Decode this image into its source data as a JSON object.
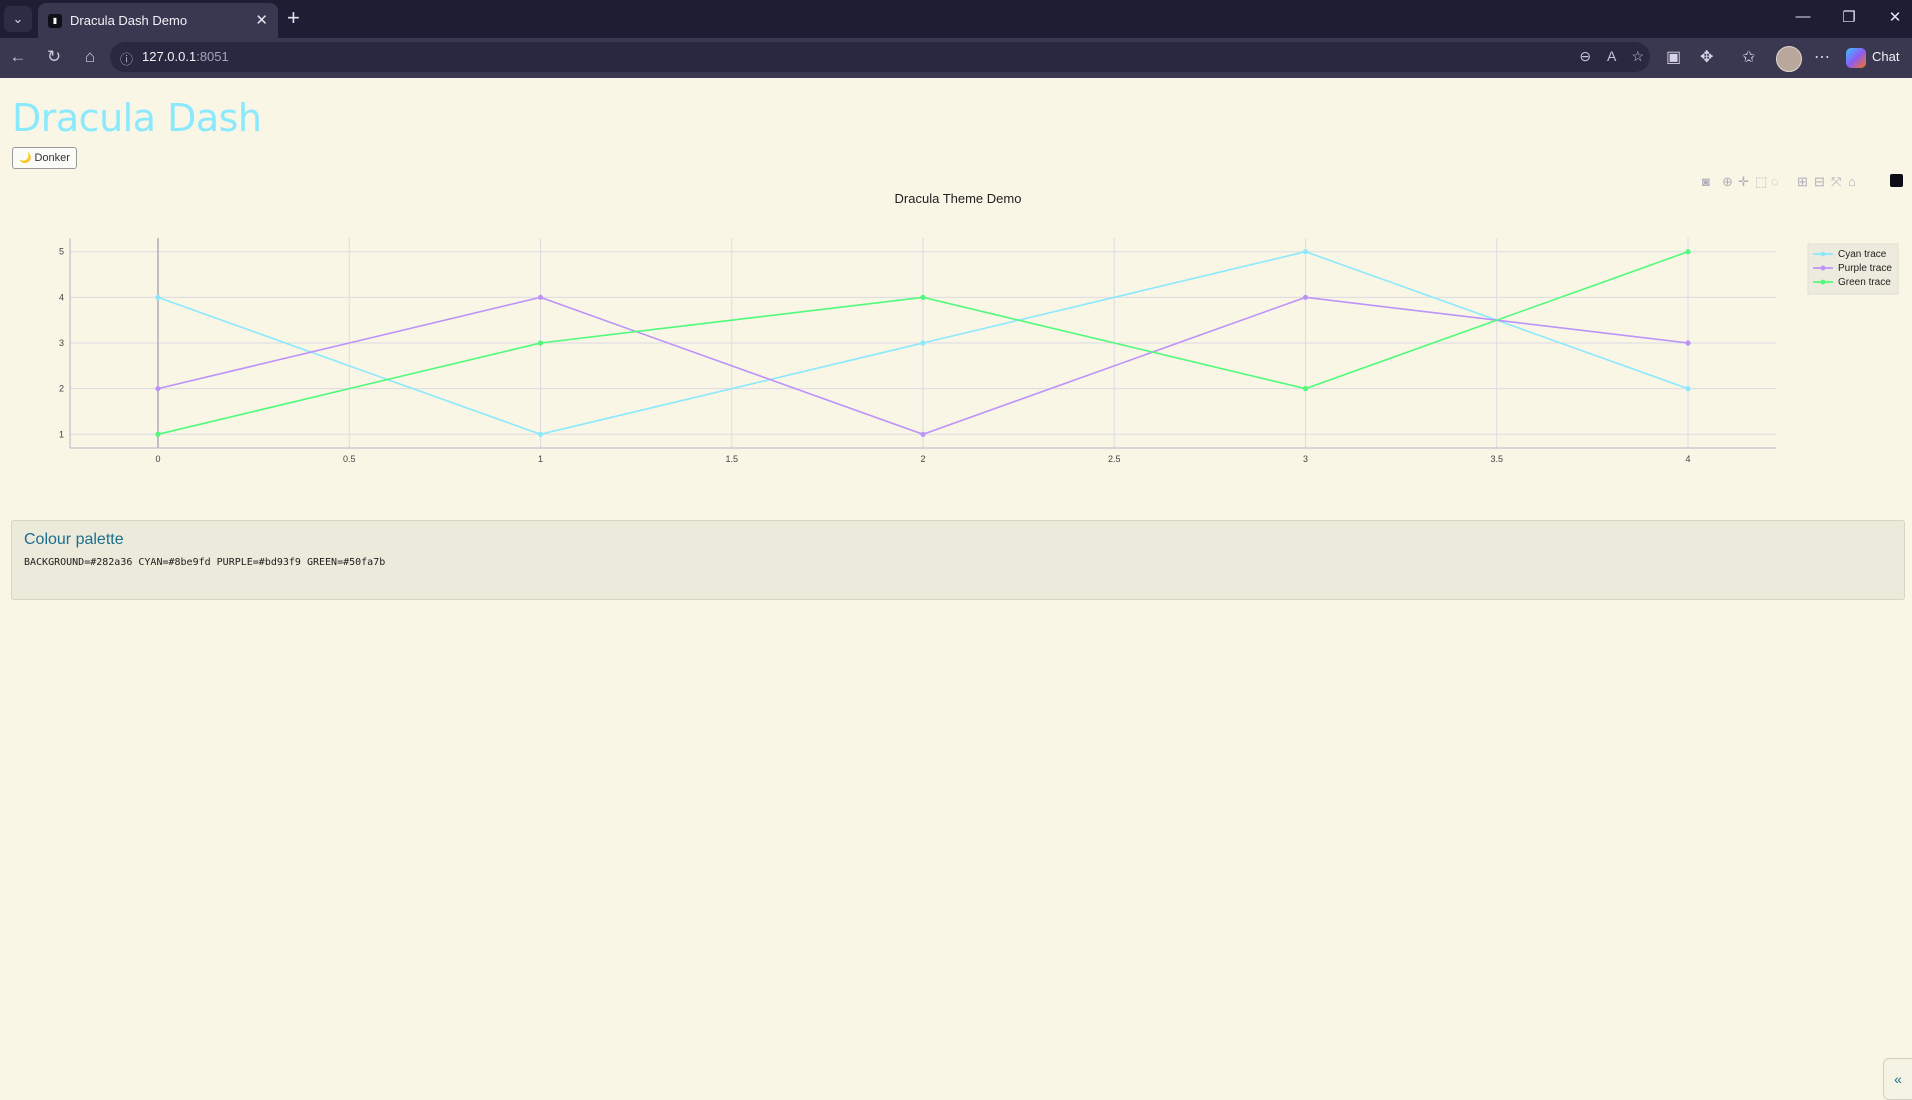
{
  "browser": {
    "tab_title": "Dracula Dash Demo",
    "url_host": "127.0.0.1",
    "url_port": ":8051",
    "chat_label": "Chat"
  },
  "page": {
    "title": "Dracula Dash",
    "theme_button_label": "Donker"
  },
  "chart_data": {
    "type": "line",
    "title": "Dracula Theme Demo",
    "xlabel": "",
    "ylabel": "",
    "x": [
      0,
      1,
      2,
      3,
      4
    ],
    "x_ticks": [
      "0",
      "0.5",
      "1",
      "1.5",
      "2",
      "2.5",
      "3",
      "3.5",
      "4"
    ],
    "y_ticks": [
      "1",
      "2",
      "3",
      "4",
      "5"
    ],
    "xlim": [
      -0.23,
      4.23
    ],
    "ylim": [
      0.7,
      5.3
    ],
    "grid": true,
    "legend_position": "top-right",
    "series": [
      {
        "name": "Cyan trace",
        "color": "#8be9fd",
        "values": [
          4,
          1,
          3,
          5,
          2
        ]
      },
      {
        "name": "Purple trace",
        "color": "#bd93f9",
        "values": [
          2,
          4,
          1,
          4,
          3
        ]
      },
      {
        "name": "Green trace",
        "color": "#50fa7b",
        "values": [
          1,
          3,
          4,
          2,
          5
        ]
      }
    ]
  },
  "palette": {
    "title": "Colour palette",
    "text": "BACKGROUND=#282a36 CYAN=#8be9fd PURPLE=#bd93f9 GREEN=#50fa7b"
  }
}
